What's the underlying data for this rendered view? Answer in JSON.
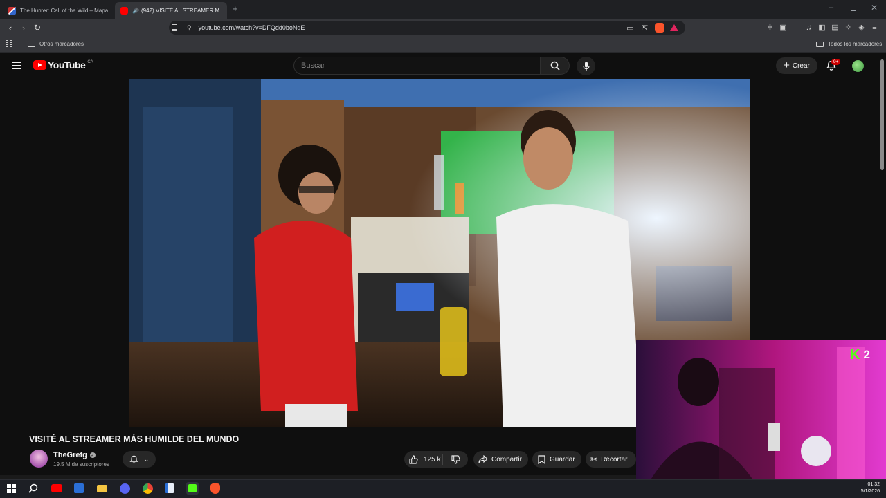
{
  "browser": {
    "tabs": [
      {
        "title": "The Hunter: Call of the Wild – Mapa...",
        "active": false
      },
      {
        "title": "(942) VISITÉ AL STREAMER M...",
        "active": true
      }
    ],
    "url": "youtube.com/watch?v=DFQdd0boNqE",
    "bookmarks": {
      "left": "Otros marcadores",
      "right": "Todos los marcadores"
    }
  },
  "youtube": {
    "logo_text": "YouTube",
    "region": "CA",
    "search_placeholder": "Buscar",
    "create_label": "Crear",
    "notifications_badge": "9+"
  },
  "video": {
    "title": "VISITÉ AL STREAMER MÁS HUMILDE DEL MUNDO",
    "channel_name": "TheGrefg",
    "subscribers": "19.5 M de suscriptores",
    "likes": "125 k",
    "share_label": "Compartir",
    "save_label": "Guardar",
    "clip_label": "Recortar"
  },
  "overlay": {
    "kick_count": "2"
  },
  "taskbar": {
    "time": "01:32",
    "date": "5/1/2026"
  },
  "colors": {
    "youtube_red": "#ff0000",
    "kick_green": "#53fc18",
    "tab_active": "#35363a"
  }
}
